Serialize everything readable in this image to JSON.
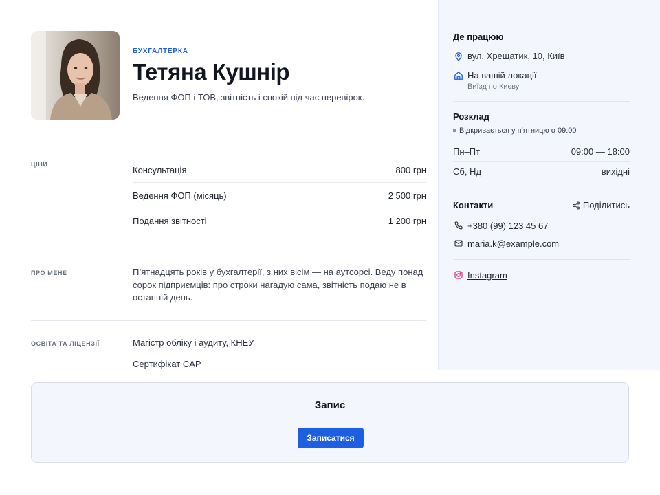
{
  "profile": {
    "category": "БУХГАЛТЕРКА",
    "name": "Тетяна Кушнір",
    "tagline": "Ведення ФОП і ТОВ, звітність і спокій під час перевірок."
  },
  "prices": {
    "label": "ЦІНИ",
    "items": [
      {
        "service": "Консультація",
        "price": "800 грн"
      },
      {
        "service": "Ведення ФОП (місяць)",
        "price": "2 500 грн"
      },
      {
        "service": "Подання звітності",
        "price": "1 200 грн"
      }
    ]
  },
  "about": {
    "label": "ПРО МЕНЕ",
    "text": "П’ятнадцять років у бухгалтерії, з них вісім — на аутсорсі. Веду понад сорок підприємців: про строки нагадую сама, звітність подаю не в останній день."
  },
  "education": {
    "label": "ОСВІТА ТА ЛІЦЕНЗІЇ",
    "items": [
      "Магістр обліку і аудиту, КНЕУ",
      "Сертифікат CAP"
    ]
  },
  "sidebar": {
    "location": {
      "title": "Де працюю",
      "address": "вул. Хрещатик, 10, Київ",
      "onsite": "На вашій локації",
      "onsite_note": "Виїзд по Києву",
      "pin_icon": "map-pin-icon",
      "home_icon": "home-icon"
    },
    "schedule": {
      "title": "Розклад",
      "status": "Відкривається у пʼятницю о 09:00",
      "rows": [
        {
          "days": "Пн–Пт",
          "hours": "09:00 — 18:00"
        },
        {
          "days": "Сб, Нд",
          "hours": "вихідні"
        }
      ]
    },
    "contacts": {
      "title": "Контакти",
      "share_label": "Поділитись",
      "phone": "+380 (99) 123 45 67",
      "email": "maria.k@example.com",
      "instagram": "Instagram"
    }
  },
  "booking": {
    "title": "Запис",
    "button_label": "Записатися"
  },
  "colors": {
    "accent": "#1d5fe0",
    "sidebar_bg": "#f3f6fd",
    "instagram": "#e1306c"
  }
}
